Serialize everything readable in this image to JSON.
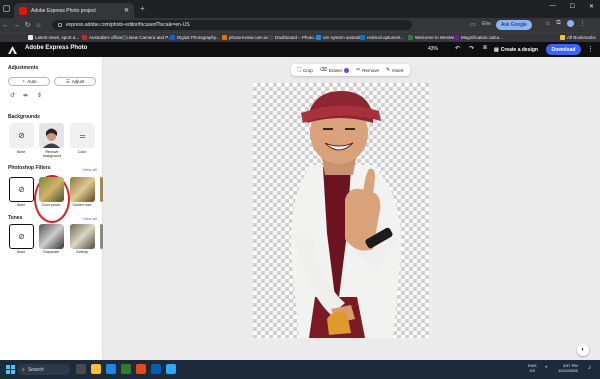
{
  "browser": {
    "tab_title": "Adobe Express Photo project",
    "new_tab": "+",
    "window_controls": {
      "minimize": "—",
      "maximize": "☐",
      "close": "✕"
    },
    "url": "express.adobe.com/photo-editor/focused?locale=en-US",
    "ask_google": "Ask Google",
    "profile_label": "Ehe",
    "bookmarks": [
      "Latest news, sport a...",
      "Australia's official w...",
      "New Camera and P...",
      "Digital Photography...",
      "photoreview.com.au",
      "Dashboard – Photo...",
      "om system australia",
      "redmail.optusnet...",
      "Welcome to WesMe...",
      "Magnification calcu..."
    ],
    "all_bookmarks": "All Bookmarks"
  },
  "app": {
    "title": "Adobe Express Photo",
    "zoom": "43%",
    "create_design": "Create a design",
    "download": "Download"
  },
  "panel": {
    "adjustments_heading": "Adjustments",
    "auto_label": "Auto",
    "adjust_label": "Adjust",
    "backgrounds_heading": "Backgrounds",
    "bg_options": [
      {
        "label": "None"
      },
      {
        "label": "Remove background"
      },
      {
        "label": "Color"
      }
    ],
    "filters_heading": "Photoshop Filters",
    "filters_view_all": "View all",
    "filters": [
      {
        "label": "None"
      },
      {
        "label": "Color punch"
      },
      {
        "label": "Golden hour"
      }
    ],
    "tones_heading": "Tones",
    "tones_view_all": "View all",
    "tones": [
      {
        "label": "None"
      },
      {
        "label": "Grayscale"
      },
      {
        "label": "Overlay"
      }
    ]
  },
  "toolbar": {
    "crop": "Crop",
    "eraser": "Eraser",
    "remove": "Remove",
    "insert": "Insert"
  },
  "taskbar": {
    "search": "Search",
    "lang_line1": "ENG",
    "lang_line2": "US",
    "time": "3:57 PM",
    "date": "11/02/2026"
  },
  "colors": {
    "accent": "#3b63fb",
    "annotation": "#e01d24",
    "app_header": "#0f0f0f"
  }
}
